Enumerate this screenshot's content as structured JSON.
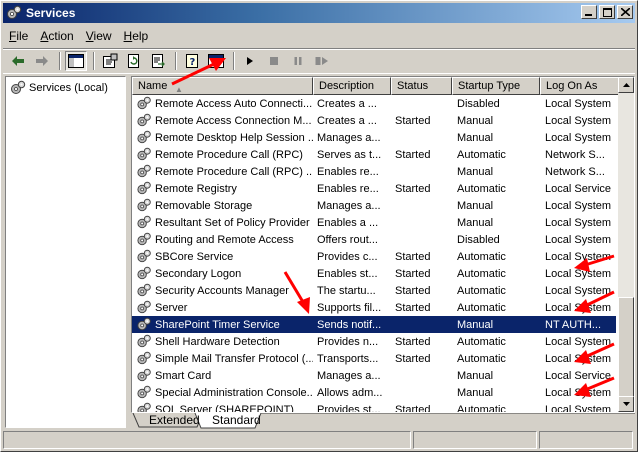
{
  "window": {
    "title": "Services"
  },
  "menu": [
    {
      "key": "F",
      "rest": "ile"
    },
    {
      "key": "A",
      "rest": "ction"
    },
    {
      "key": "V",
      "rest": "iew"
    },
    {
      "key": "H",
      "rest": "elp"
    }
  ],
  "tree": {
    "root_label": "Services (Local)"
  },
  "columns": {
    "name": "Name",
    "description": "Description",
    "status": "Status",
    "startup": "Startup Type",
    "logon": "Log On As"
  },
  "rows": [
    {
      "name": "Remote Access Auto Connecti...",
      "description": "Creates a ...",
      "status": "",
      "startup": "Disabled",
      "logon": "Local System"
    },
    {
      "name": "Remote Access Connection M...",
      "description": "Creates a ...",
      "status": "Started",
      "startup": "Manual",
      "logon": "Local System"
    },
    {
      "name": "Remote Desktop Help Session ...",
      "description": "Manages a...",
      "status": "",
      "startup": "Manual",
      "logon": "Local System"
    },
    {
      "name": "Remote Procedure Call (RPC)",
      "description": "Serves as t...",
      "status": "Started",
      "startup": "Automatic",
      "logon": "Network S..."
    },
    {
      "name": "Remote Procedure Call (RPC) ...",
      "description": "Enables re...",
      "status": "",
      "startup": "Manual",
      "logon": "Network S..."
    },
    {
      "name": "Remote Registry",
      "description": "Enables re...",
      "status": "Started",
      "startup": "Automatic",
      "logon": "Local Service"
    },
    {
      "name": "Removable Storage",
      "description": "Manages a...",
      "status": "",
      "startup": "Manual",
      "logon": "Local System"
    },
    {
      "name": "Resultant Set of Policy Provider",
      "description": "Enables a ...",
      "status": "",
      "startup": "Manual",
      "logon": "Local System"
    },
    {
      "name": "Routing and Remote Access",
      "description": "Offers rout...",
      "status": "",
      "startup": "Disabled",
      "logon": "Local System"
    },
    {
      "name": "SBCore Service",
      "description": "Provides c...",
      "status": "Started",
      "startup": "Automatic",
      "logon": "Local System"
    },
    {
      "name": "Secondary Logon",
      "description": "Enables st...",
      "status": "Started",
      "startup": "Automatic",
      "logon": "Local System"
    },
    {
      "name": "Security Accounts Manager",
      "description": "The startu...",
      "status": "Started",
      "startup": "Automatic",
      "logon": "Local System"
    },
    {
      "name": "Server",
      "description": "Supports fil...",
      "status": "Started",
      "startup": "Automatic",
      "logon": "Local System"
    },
    {
      "name": "SharePoint Timer Service",
      "description": "Sends notif...",
      "status": "",
      "startup": "Manual",
      "logon": "NT AUTH...",
      "selected": true
    },
    {
      "name": "Shell Hardware Detection",
      "description": "Provides n...",
      "status": "Started",
      "startup": "Automatic",
      "logon": "Local System"
    },
    {
      "name": "Simple Mail Transfer Protocol (...",
      "description": "Transports...",
      "status": "Started",
      "startup": "Automatic",
      "logon": "Local System"
    },
    {
      "name": "Smart Card",
      "description": "Manages a...",
      "status": "",
      "startup": "Manual",
      "logon": "Local Service"
    },
    {
      "name": "Special Administration Console...",
      "description": "Allows adm...",
      "status": "",
      "startup": "Manual",
      "logon": "Local System"
    },
    {
      "name": "SQL Server (SHAREPOINT)",
      "description": "Provides st...",
      "status": "Started",
      "startup": "Automatic",
      "logon": "Local System"
    }
  ],
  "tabs": {
    "extended": "Extended",
    "standard": "Standard"
  },
  "colors": {
    "selection": "#0a246a",
    "annotation_arrow": "#ff0000",
    "gear": "#6b6b6b"
  },
  "icons": {
    "toolbar": [
      "back-arrow-icon",
      "forward-arrow-icon",
      "show-hide-tree-icon",
      "properties-icon",
      "refresh-icon",
      "export-list-icon",
      "help-icon",
      "mmc-icon",
      "start-service-icon",
      "stop-service-icon",
      "pause-service-icon",
      "restart-service-icon"
    ],
    "service": "gear-icon"
  }
}
